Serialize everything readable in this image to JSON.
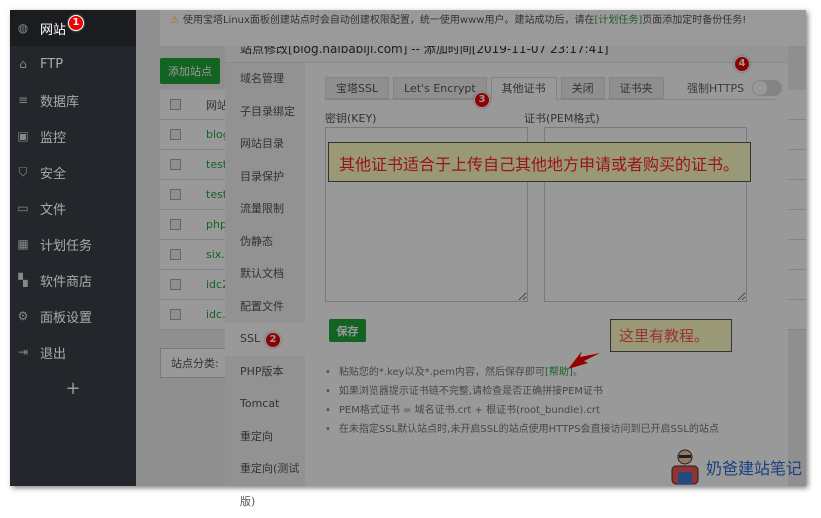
{
  "sidebar": {
    "items": [
      {
        "label": "网站",
        "icon": "globe-icon",
        "glyph": "◍"
      },
      {
        "label": "FTP",
        "icon": "ftp-icon",
        "glyph": "⌂"
      },
      {
        "label": "数据库",
        "icon": "database-icon",
        "glyph": "≡"
      },
      {
        "label": "监控",
        "icon": "monitor-icon",
        "glyph": "▣"
      },
      {
        "label": "安全",
        "icon": "shield-icon",
        "glyph": "⛉"
      },
      {
        "label": "文件",
        "icon": "folder-icon",
        "glyph": "▭"
      },
      {
        "label": "计划任务",
        "icon": "calendar-icon",
        "glyph": "▦"
      },
      {
        "label": "软件商店",
        "icon": "apps-icon",
        "glyph": "▚"
      },
      {
        "label": "面板设置",
        "icon": "gear-icon",
        "glyph": "⚙"
      },
      {
        "label": "退出",
        "icon": "logout-icon",
        "glyph": "⇥"
      }
    ],
    "add": "+"
  },
  "background": {
    "warning_pre": "使用宝塔Linux面板创建站点时会自动创建权限配置，统一使用www用户。建站成功后，请在",
    "warning_link": "[计划任务]",
    "warning_post": "页面添加定时备份任务!",
    "add_site": "添加站点",
    "col_site": "网站",
    "sites": [
      "blog",
      "test.",
      "test.",
      "php",
      "six.p",
      "idc2.",
      "idc.p"
    ],
    "category": "站点分类:"
  },
  "modal": {
    "title": "站点修改[blog.naibabiji.com] -- 添加时间[2019-11-07 23:17:41]",
    "close": "×",
    "menu": [
      "域名管理",
      "子目录绑定",
      "网站目录",
      "目录保护",
      "流量限制",
      "伪静态",
      "默认文档",
      "配置文件",
      "SSL",
      "PHP版本",
      "Tomcat",
      "重定向",
      "重定向(测试版)"
    ],
    "tabs": [
      "宝塔SSL",
      "Let's Encrypt",
      "其他证书",
      "关闭",
      "证书夹"
    ],
    "force_https": "强制HTTPS",
    "force_https_on": false,
    "key_label": "密钥(KEY)",
    "cert_label": "证书(PEM格式)",
    "key_value": "",
    "cert_value": "",
    "save": "保存",
    "tips": [
      "粘贴您的*.key以及*.pem内容，然后保存即可",
      "如果浏览器提示证书链不完整,请检查是否正确拼接PEM证书",
      "PEM格式证书 = 域名证书.crt + 根证书(root_bundle).crt",
      "在未指定SSL默认站点时,未开启SSL的站点使用HTTPS会直接访问到已开启SSL的站点"
    ],
    "help": "[帮助]",
    "help_tail": "。"
  },
  "annotations": {
    "note1": "其他证书适合于上传自己其他地方申请或者购买的证书。",
    "note2": "这里有教程。",
    "badges": [
      "1",
      "2",
      "3",
      "4"
    ]
  },
  "brand": "奶爸建站笔记",
  "colors": {
    "accent": "#20a53a",
    "sidebar": "#23262b",
    "badge": "#e00000",
    "note": "#ffffc8"
  }
}
